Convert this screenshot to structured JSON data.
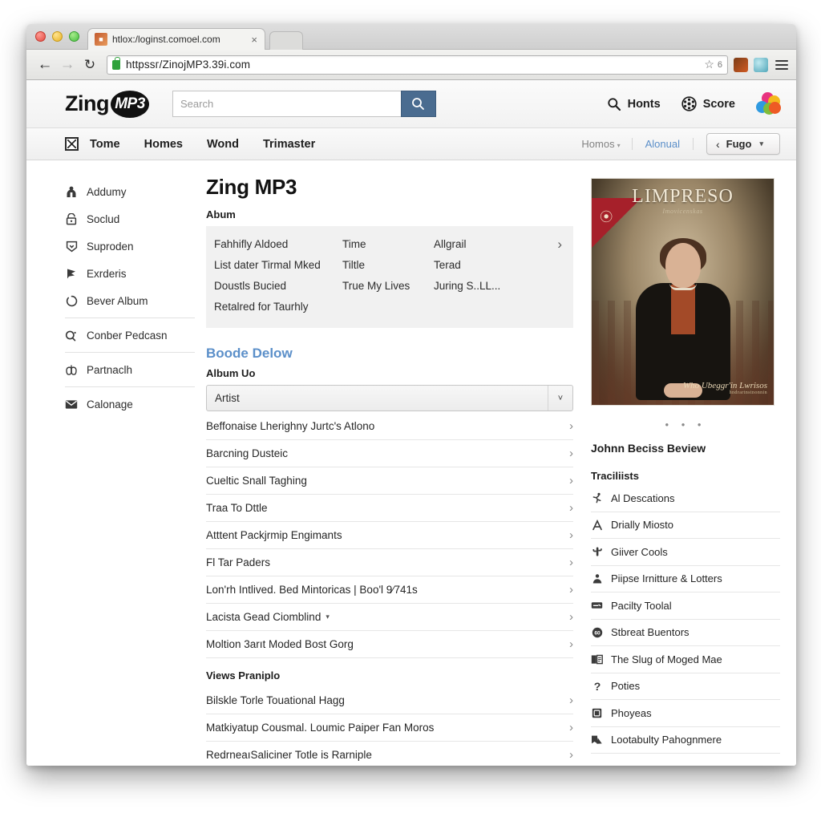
{
  "browser": {
    "tab_title": "htlox:/loginst.comoel.com",
    "tab_close": "×",
    "url": "httpsѕг/ZinojMP3.39і.com",
    "bookmark_count": "6",
    "back_icon": "back-arrow-icon",
    "forward_icon": "forward-arrow-icon",
    "reload_icon": "reload-icon"
  },
  "header": {
    "brand_first": "Zing",
    "brand_badge": "MP3",
    "search_placeholder": "Search",
    "search_value": "",
    "links": [
      {
        "label": "Honts",
        "icon": "search-icon"
      },
      {
        "label": "Score",
        "icon": "film-reel-icon"
      }
    ]
  },
  "nav": {
    "items": [
      "Tome",
      "Homes",
      "Wond",
      "Trimaster"
    ],
    "secondary": "Homos",
    "secondary_caret": "▾",
    "link": "Alonual",
    "pill_label": "Fugo",
    "pill_left": "‹",
    "pill_caret": "▾"
  },
  "sidebar": {
    "items": [
      {
        "label": "Addumy",
        "icon": "person-badge-icon",
        "sep_after": false
      },
      {
        "label": "Soclud",
        "icon": "unlock-icon",
        "sep_after": false
      },
      {
        "label": "Suproden",
        "icon": "shield-down-icon",
        "sep_after": false
      },
      {
        "label": "Exrderis",
        "icon": "flag-icon",
        "sep_after": false
      },
      {
        "label": "Bever Album",
        "icon": "refresh-circle-icon",
        "sep_after": true
      },
      {
        "label": "Conber Pedcasn",
        "icon": "podcast-icon",
        "sep_after": true
      },
      {
        "label": "Partnaclh",
        "icon": "lungs-icon",
        "sep_after": true
      },
      {
        "label": "Calonage",
        "icon": "envelope-icon",
        "sep_after": false
      }
    ]
  },
  "main": {
    "title": "Zing MP3",
    "album_label": "Abum",
    "album_facts": [
      [
        "Fahhifly Aldoed",
        "Time",
        "Allgrail"
      ],
      [
        "List dater Tirmal Mked",
        "Tiltle",
        "Terad"
      ],
      [
        "Doustls Bucied",
        "True My Lives",
        "Juring S..LL..."
      ],
      [
        "Retalred for Taurhly",
        "",
        ""
      ]
    ],
    "album_chevron": "›",
    "boode_heading": "Boode Delow",
    "album_up_label": "Album Uo",
    "select_value": "Artist",
    "select_caret": "˅",
    "rows": [
      {
        "label": "Beffonaise Lherighny Jurtc's Atlono"
      },
      {
        "label": "Barcning Dusteic"
      },
      {
        "label": "Cueltic Snall Taghing"
      },
      {
        "label": "Traa To Dttle"
      },
      {
        "label": "Atttent Packjrmip Engimants"
      },
      {
        "label": "Fl Tar Paders"
      },
      {
        "label": "Lon'rh Intlived. Bed Mintoricas | Boo'l 9⁄741s"
      },
      {
        "label": "Lacista Gead Ciomblind",
        "caret": "▾"
      },
      {
        "label": "Moltion 3arıt Moded Bost Gorg"
      }
    ],
    "views_label": "Views Praniplo",
    "views_rows": [
      {
        "label": "Bilskle Torle Touational Hagg"
      },
      {
        "label": "Matkiyatup Cousmal. Loumic Paiper Fan Moros"
      },
      {
        "label": "RedrneaıSaliciner Totle is Rarniple"
      }
    ],
    "row_chevron": "›"
  },
  "cover": {
    "title": "LIMPRESO",
    "subtitle": "Imovicenskas",
    "footer_line1": "Who Ubeggr'in Lwrisos",
    "footer_line2": "hndrartnstnonnin"
  },
  "right": {
    "dots": "• • •",
    "review_title": "Johnn Beciss Beview",
    "tracklist_label": "Traciliists",
    "tracks": [
      {
        "label": "Al Descations",
        "icon": "runner-icon"
      },
      {
        "label": "Drially Miosto",
        "icon": "letter-a-icon"
      },
      {
        "label": "Giiver Cools",
        "icon": "cactus-icon"
      },
      {
        "label": "Piipse Irnitture & Lotters",
        "icon": "person-stand-icon"
      },
      {
        "label": "Pacilty Toolal",
        "icon": "ticket-icon"
      },
      {
        "label": "Stbreat Buentors",
        "icon": "badge-60-icon"
      },
      {
        "label": "The Slug of Moged Mae",
        "icon": "book-icon"
      },
      {
        "label": "Poties",
        "icon": "question-mark-icon"
      },
      {
        "label": "Phoyeas",
        "icon": "box-letter-icon"
      },
      {
        "label": "Lootabulty Pahognmere",
        "icon": "bookmark-stack-icon"
      }
    ]
  },
  "colors": {
    "accent_blue": "#5b8fc9",
    "search_button": "#4a6c90",
    "panel_gray": "#f1f1f1",
    "border": "#e6e6e6"
  }
}
